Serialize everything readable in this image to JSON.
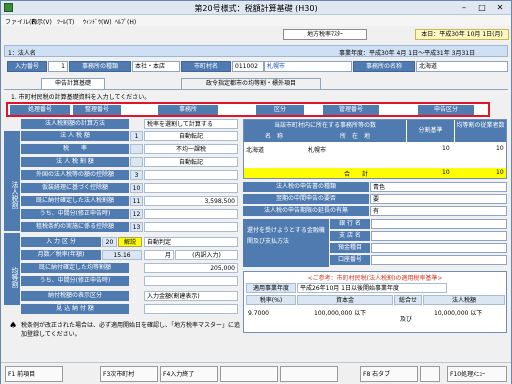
{
  "window": {
    "title": "第20号様式：税額計算基礎 (H30)",
    "min": "–",
    "max": "□",
    "close": "✕"
  },
  "menu": [
    "ファイル(F)",
    "表示(V)",
    "ﾂｰﾙ(T)",
    "ｳｨﾝﾄﾞｳ(W)",
    "ﾍﾙﾌﾟ(H)"
  ],
  "toolbar": {
    "master_button": "地方税率ﾏｽﾀｰ",
    "today": "本日：平成30年 10月 1日(月)"
  },
  "header": {
    "corp_label": "1：法人名",
    "fiscal": "事業年度：平成30年 4月 1日～平成31年 3月31日",
    "input_no_label": "入力番号",
    "input_no": "1",
    "office_type_label": "事務所の種類",
    "office_type": "本社・本店",
    "city_name_label": "市町村名",
    "city_code": "011002",
    "city_name": "札幌市",
    "office_name_label": "事務所の名称",
    "office_name": "北海道"
  },
  "tabs": [
    "申告計算基礎",
    "政令指定都市の均等割・標外項目"
  ],
  "instruction": "1. 市町村民税の計算基礎資料を入力してください。",
  "red_headers": [
    "処理番号",
    "整理番号",
    "事務所",
    "区分",
    "管理番号",
    "申告区分"
  ],
  "left": {
    "side_top": "法人税割",
    "side_mid": "均等割",
    "rows": [
      {
        "label": "法人税割額の計算方法",
        "num": "",
        "value": "税率を選割して計算する"
      },
      {
        "label": "法 人 税 額",
        "num": "1",
        "value": "自動転記"
      },
      {
        "label": "税　　率",
        "num": "",
        "value": "不均一課税"
      },
      {
        "label": "法 人 税 割 額",
        "num": "",
        "value": "自動転記"
      },
      {
        "label": "外国の法人税等の額の控除額",
        "num": "3",
        "value": ""
      },
      {
        "label": "仮装経理に基づく控除額",
        "num": "10",
        "value": ""
      },
      {
        "label": "既に納付確定した法人税割額",
        "num": "11",
        "value": "3,598,500"
      },
      {
        "label": "うち、中間分(修正申告時)",
        "num": "12",
        "value": ""
      },
      {
        "label": "租税条約の実施に係る控除額",
        "num": "13",
        "value": ""
      }
    ],
    "period_label": "入 力 区 分",
    "period_num": "20",
    "kaisetsu": "解説",
    "period_select": "自動判定",
    "months_label": "月数／税率(年額)",
    "months_num": "15.16",
    "months_unit": "月",
    "months_value": "(内訳入力)",
    "rows2": [
      {
        "label": "既に納付確定した均等割額",
        "num": "",
        "value": "205,000"
      },
      {
        "label": "うち、中間分(修正申告時)",
        "num": "",
        "value": ""
      },
      {
        "label": "納付税額の表示区分",
        "num": "",
        "value": "入力金額(割建表示)"
      },
      {
        "label": "見 込 納 付 額",
        "num": "",
        "value": ""
      }
    ],
    "note_icon": "♠",
    "note": "税条例が改正された場合は、必ず適用開始日を確認し、「地方税率マスター」に追加登録してください。"
  },
  "right": {
    "grid_headers": [
      "当該市町村内に所在する事務所等の数",
      "分割基準",
      "均等割の従業者数"
    ],
    "sub_headers": [
      "名　称",
      "所　在　地"
    ],
    "rows": [
      {
        "name": "北海道",
        "addr": "札幌市",
        "a": "10",
        "b": "10"
      }
    ],
    "total_label": "合　　計",
    "total_a": "10",
    "total_b": "10",
    "info": [
      {
        "label": "法人税の申告書の種類",
        "value": "青色"
      },
      {
        "label": "翌期の中間申告の要否",
        "value": "要"
      },
      {
        "label": "法人税の申告期限の延長の有無",
        "value": "有"
      }
    ],
    "bank_label": "還付を受けようとする金融機関及び支払方法",
    "bank_fields": [
      "銀 行 名",
      "支 店 名",
      "預金種目",
      "口座番号"
    ],
    "ref_title": "<ご参考：市町村民税(法人税割)の適用税率基準>",
    "ref_date_label": "適用事業年度",
    "ref_date": "平成26年10月 1日以後開始事業年度",
    "ref_cols": [
      "税率(%)",
      "資本金",
      "総合せ",
      "法人税額"
    ],
    "ref_row": {
      "rate": "9.7000",
      "cap": "100,000,000 以下",
      "and": "及び",
      "tax": "10,000,000 以下"
    }
  },
  "fkeys": [
    "F1 前項目",
    "F3次市町村",
    "F4入力終了",
    "",
    "",
    "F8 右タブ",
    "",
    "F10処理ﾒﾆｭｰ"
  ]
}
